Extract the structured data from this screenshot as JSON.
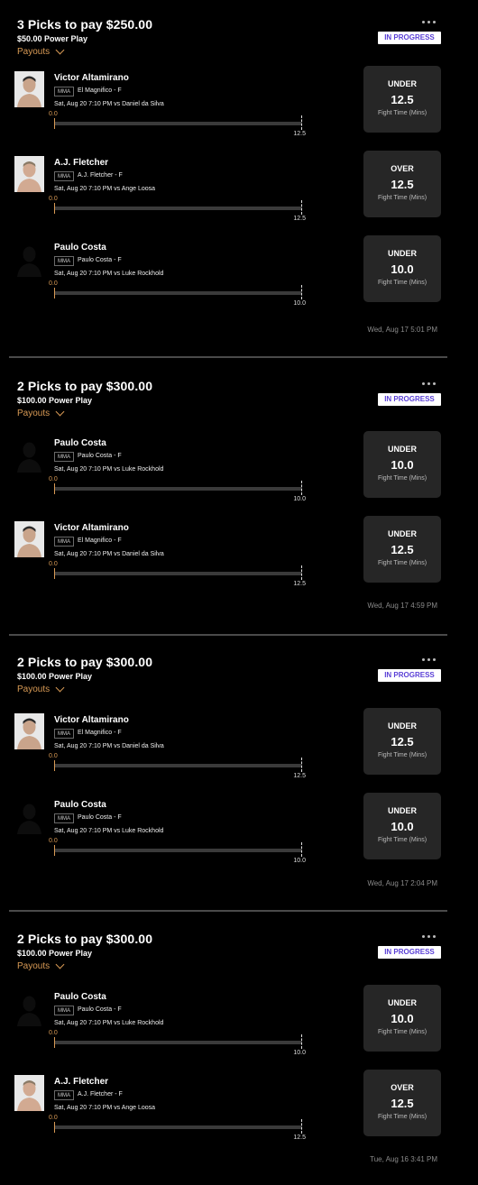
{
  "card1": {
    "title": "3 Picks to pay $250.00",
    "sub": "$50.00 Power Play",
    "payouts": "Payouts",
    "status": "IN PROGRESS",
    "timestamp": "Wed, Aug 17 5:01 PM",
    "picks": [
      {
        "name": "Victor Altamirano",
        "league": "MMA",
        "pos": "El Magnifico - F",
        "game": "Sat, Aug 20 7:10 PM  vs Daniel da Silva",
        "current": "0.0",
        "line": "12.5",
        "dir": "UNDER",
        "stat": "Fight Time (Mins)",
        "avatar": "fighter-photo"
      },
      {
        "name": "A.J. Fletcher",
        "league": "MMA",
        "pos": "A.J. Fletcher - F",
        "game": "Sat, Aug 20 7:10 PM  vs Ange Loosa",
        "current": "0.0",
        "line": "12.5",
        "dir": "OVER",
        "stat": "Fight Time (Mins)",
        "avatar": "fighter-photo"
      },
      {
        "name": "Paulo Costa",
        "league": "MMA",
        "pos": "Paulo Costa - F",
        "game": "Sat, Aug 20 7:10 PM  vs Luke Rockhold",
        "current": "0.0",
        "line": "10.0",
        "dir": "UNDER",
        "stat": "Fight Time (Mins)",
        "avatar": "silhouette"
      }
    ]
  },
  "card2": {
    "title": "2 Picks to pay $300.00",
    "sub": "$100.00 Power Play",
    "payouts": "Payouts",
    "status": "IN PROGRESS",
    "timestamp": "Wed, Aug 17 4:59 PM",
    "picks": [
      {
        "name": "Paulo Costa",
        "league": "MMA",
        "pos": "Paulo Costa - F",
        "game": "Sat, Aug 20 7:10 PM  vs Luke Rockhold",
        "current": "0.0",
        "line": "10.0",
        "dir": "UNDER",
        "stat": "Fight Time (Mins)",
        "avatar": "silhouette"
      },
      {
        "name": "Victor Altamirano",
        "league": "MMA",
        "pos": "El Magnifico - F",
        "game": "Sat, Aug 20 7:10 PM  vs Daniel da Silva",
        "current": "0.0",
        "line": "12.5",
        "dir": "UNDER",
        "stat": "Fight Time (Mins)",
        "avatar": "fighter-photo"
      }
    ]
  },
  "card3": {
    "title": "2 Picks to pay $300.00",
    "sub": "$100.00 Power Play",
    "payouts": "Payouts",
    "status": "IN PROGRESS",
    "timestamp": "Wed, Aug 17 2:04 PM",
    "picks": [
      {
        "name": "Victor Altamirano",
        "league": "MMA",
        "pos": "El Magnifico - F",
        "game": "Sat, Aug 20 7:10 PM  vs Daniel da Silva",
        "current": "0.0",
        "line": "12.5",
        "dir": "UNDER",
        "stat": "Fight Time (Mins)",
        "avatar": "fighter-photo"
      },
      {
        "name": "Paulo Costa",
        "league": "MMA",
        "pos": "Paulo Costa - F",
        "game": "Sat, Aug 20 7:10 PM  vs Luke Rockhold",
        "current": "0.0",
        "line": "10.0",
        "dir": "UNDER",
        "stat": "Fight Time (Mins)",
        "avatar": "silhouette"
      }
    ]
  },
  "card4": {
    "title": "2 Picks to pay $300.00",
    "sub": "$100.00 Power Play",
    "payouts": "Payouts",
    "status": "IN PROGRESS",
    "timestamp": "Tue, Aug 16 3:41 PM",
    "picks": [
      {
        "name": "Paulo Costa",
        "league": "MMA",
        "pos": "Paulo Costa - F",
        "game": "Sat, Aug 20 7:10 PM  vs Luke Rockhold",
        "current": "0.0",
        "line": "10.0",
        "dir": "UNDER",
        "stat": "Fight Time (Mins)",
        "avatar": "silhouette"
      },
      {
        "name": "A.J. Fletcher",
        "league": "MMA",
        "pos": "A.J. Fletcher - F",
        "game": "Sat, Aug 20 7:10 PM  vs Ange Loosa",
        "current": "0.0",
        "line": "12.5",
        "dir": "OVER",
        "stat": "Fight Time (Mins)",
        "avatar": "fighter-photo"
      }
    ]
  },
  "colors": {
    "background": "#000000",
    "accent": "#d89a55",
    "badge_text": "#5a3fd6",
    "box_bg": "#262626"
  }
}
